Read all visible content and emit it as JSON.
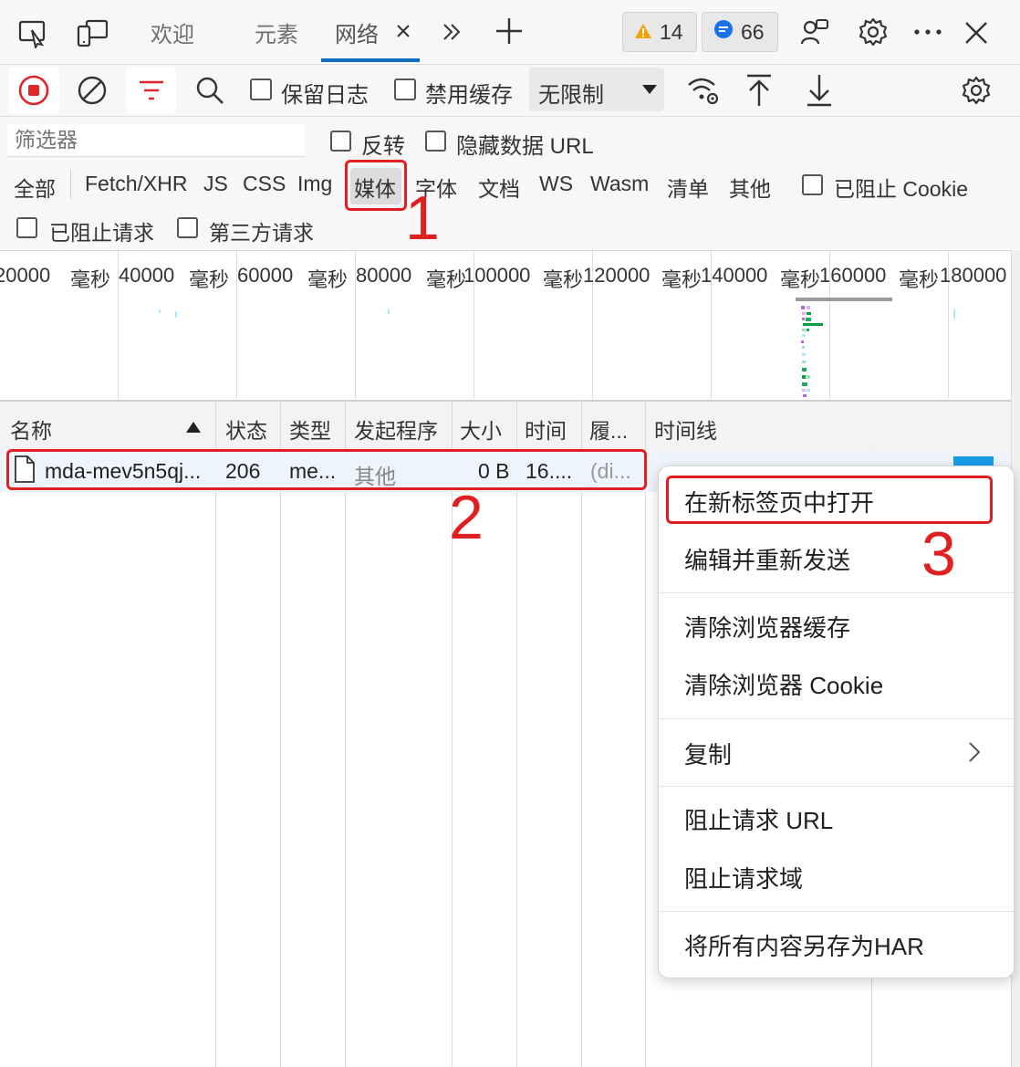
{
  "tabs": {
    "welcome": "欢迎",
    "elements": "元素",
    "network": "网络",
    "warnings_count": "14",
    "messages_count": "66"
  },
  "toolbar": {
    "preserve_log": "保留日志",
    "disable_cache": "禁用缓存",
    "throttling": "无限制"
  },
  "filter": {
    "placeholder": "筛选器",
    "invert": "反转",
    "hide_data_urls": "隐藏数据 URL",
    "types": [
      "全部",
      "Fetch/XHR",
      "JS",
      "CSS",
      "Img",
      "媒体",
      "字体",
      "文档",
      "WS",
      "Wasm",
      "清单",
      "其他"
    ],
    "blocked_cookies": "已阻止 Cookie",
    "blocked_requests": "已阻止请求",
    "third_party": "第三方请求"
  },
  "overview": {
    "labels": [
      "20000",
      "毫秒",
      "40000",
      "毫秒",
      "60000",
      "毫秒",
      "80000",
      "毫秒",
      "100000",
      "毫秒",
      "120000",
      "毫秒",
      "140000",
      "毫秒",
      "160000",
      "毫秒",
      "180000"
    ]
  },
  "table": {
    "columns": [
      "名称",
      "状态",
      "类型",
      "发起程序",
      "大小",
      "时间",
      "履...",
      "时间线"
    ],
    "row": {
      "name": "mda-mev5n5qj...",
      "status": "206",
      "type": "me...",
      "initiator": "其他",
      "size": "0 B",
      "time": "16....",
      "fulfilled": "(di..."
    }
  },
  "context_menu": {
    "items": [
      "在新标签页中打开",
      "编辑并重新发送",
      "清除浏览器缓存",
      "清除浏览器 Cookie",
      "复制",
      "阻止请求 URL",
      "阻止请求域",
      "将所有内容另存为HAR"
    ]
  },
  "annotations": [
    "1",
    "2",
    "3"
  ],
  "colors": {
    "annotation_red": "#e02020",
    "record_red": "#e0262a",
    "accent_blue": "#0f6cbd"
  }
}
